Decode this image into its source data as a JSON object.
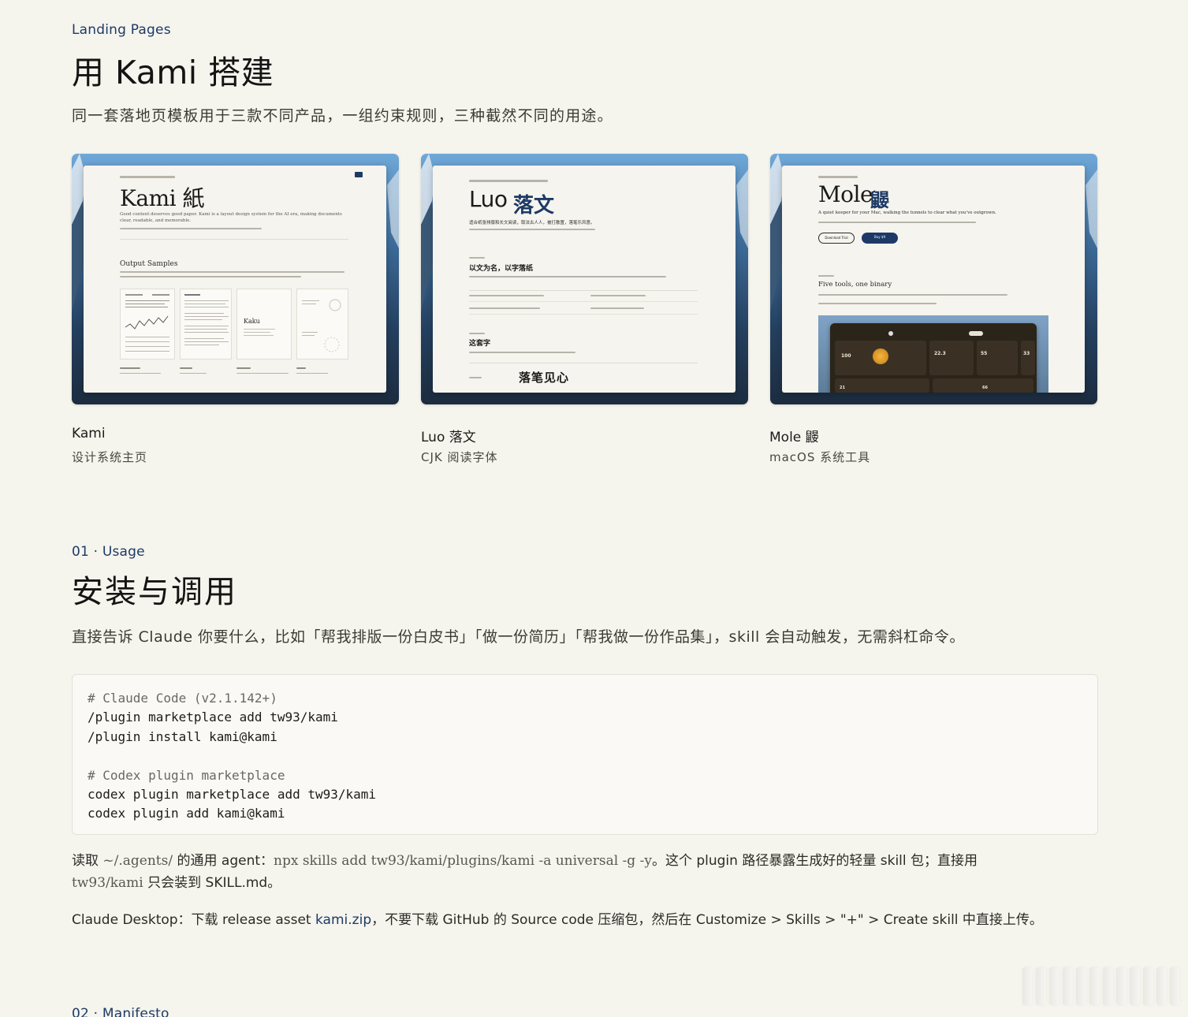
{
  "landing": {
    "eyebrow": "Landing Pages",
    "title": "用 Kami 搭建",
    "lead": "同一套落地页模板用于三款不同产品，一组约束规则，三种截然不同的用途。"
  },
  "cards": [
    {
      "name": "Kami",
      "desc": "设计系统主页",
      "preview_title": "Kami 紙",
      "preview_sub": "Good content deserves good paper. Kami is a layout design system for the AI era, making documents clear, readable, and memorable.",
      "preview_section": "Output Samples",
      "preview_item": "Kaku"
    },
    {
      "name": "Luo 落文",
      "desc": "CJK 阅读字体",
      "preview_title": "Luo",
      "preview_title_cjk": "落文",
      "preview_sub": "适合纸张排版和长文阅读，取法古人人，被打散置，落笔乐风意。",
      "preview_section": "以文为名，以字落纸",
      "preview_section2": "这套字",
      "preview_display": "落笔见心"
    },
    {
      "name": "Mole 鼹",
      "desc": "macOS 系统工具",
      "preview_title": "Mole",
      "preview_title_cjk": "鼹",
      "preview_sub": "A quiet keeper for your Mac, walking the tunnels to clear what you've outgrown.",
      "preview_btn1": "Download Trial",
      "preview_btn2": "Buy $9",
      "preview_section": "Five tools, one binary",
      "preview_stats": [
        "100",
        "22.3",
        "55",
        "33",
        "21",
        "66"
      ]
    }
  ],
  "usage": {
    "eyebrow": "01 · Usage",
    "title": "安装与调用",
    "lead": "直接告诉 Claude 你要什么，比如「帮我排版一份白皮书」「做一份简历」「帮我做一份作品集」，skill 会自动触发，无需斜杠命令。",
    "code_lines": [
      {
        "text": "# Claude Code (v2.1.142+)",
        "comment": true
      },
      {
        "text": "/plugin marketplace add tw93/kami",
        "comment": false
      },
      {
        "text": "/plugin install kami@kami",
        "comment": false
      },
      {
        "text": "",
        "comment": false
      },
      {
        "text": "# Codex plugin marketplace",
        "comment": true
      },
      {
        "text": "codex plugin marketplace add tw93/kami",
        "comment": false
      },
      {
        "text": "codex plugin add kami@kami",
        "comment": false
      }
    ],
    "note1_a": "读取 ",
    "note1_path": "~/.agents/",
    "note1_b": " 的通用 agent：",
    "note1_cmd": "npx skills add tw93/kami/plugins/kami -a universal -g -y",
    "note1_c": "。这个 plugin 路径暴露生成好的轻量 skill 包；直接用",
    "note1_d": "tw93/kami",
    "note1_e": " 只会装到 SKILL.md。",
    "note2_a": "Claude Desktop：下载 release asset ",
    "note2_link": "kami.zip",
    "note2_b": "，不要下载 GitHub 的 Source code 压缩包，然后在 Customize > Skills > \"+\" > Create skill 中直接上传。"
  },
  "manifesto": {
    "eyebrow": "02 · Manifesto"
  },
  "colors": {
    "background": "#f5f4ed",
    "accent": "#1d3a66",
    "code_bg": "#faf9f5"
  }
}
